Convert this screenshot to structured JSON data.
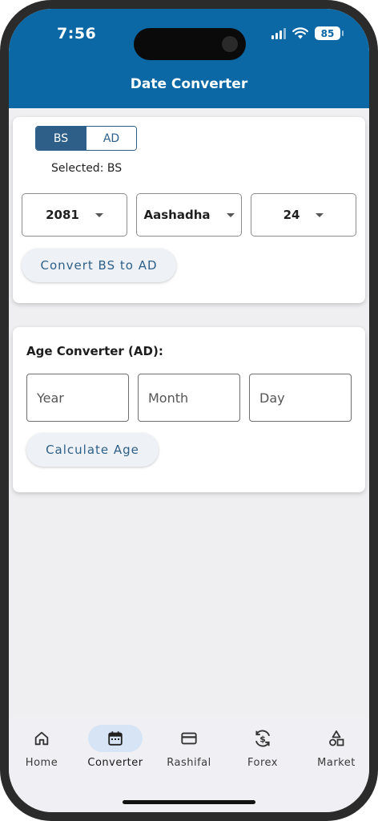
{
  "status_bar": {
    "time": "7:56",
    "battery": "85"
  },
  "header": {
    "title": "Date Converter"
  },
  "converter": {
    "segment": [
      {
        "label": "BS",
        "active": true
      },
      {
        "label": "AD",
        "active": false
      }
    ],
    "selected_text": "Selected: BS",
    "year": "2081",
    "month": "Aashadha",
    "day": "24",
    "convert_label": "Convert BS to AD"
  },
  "age": {
    "title": "Age Converter (AD):",
    "year_placeholder": "Year",
    "month_placeholder": "Month",
    "day_placeholder": "Day",
    "button_label": "Calculate Age"
  },
  "nav": {
    "items": [
      {
        "label": "Home",
        "icon": "home-icon"
      },
      {
        "label": "Converter",
        "icon": "calendar-icon",
        "active": true
      },
      {
        "label": "Rashifal",
        "icon": "card-icon"
      },
      {
        "label": "Forex",
        "icon": "currency-exchange-icon"
      },
      {
        "label": "Market",
        "icon": "shapes-icon"
      }
    ]
  },
  "colors": {
    "primary": "#0b68a5",
    "segment": "#2d5f88",
    "nav_active_bg": "#d6e4f5"
  }
}
